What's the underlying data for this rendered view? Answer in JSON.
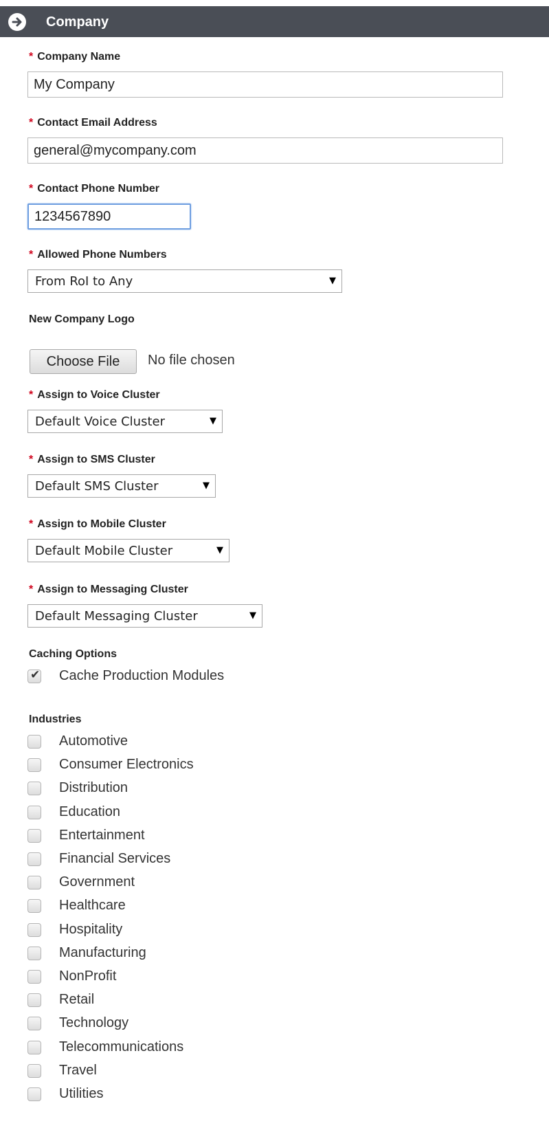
{
  "header": {
    "title": "Company",
    "icon": "arrow-right-circle-icon"
  },
  "form": {
    "company_name": {
      "required": "*",
      "label": "Company Name",
      "value": "My Company"
    },
    "contact_email": {
      "required": "*",
      "label": "Contact Email Address",
      "value": "general@mycompany.com"
    },
    "contact_phone": {
      "required": "*",
      "label": "Contact Phone Number",
      "value": "1234567890"
    },
    "allowed_phone_numbers": {
      "required": "*",
      "label": "Allowed Phone Numbers",
      "selected": "From RoI to Any"
    },
    "logo": {
      "label": "New Company Logo",
      "button": "Choose File",
      "status": "No file chosen"
    },
    "voice_cluster": {
      "required": "*",
      "label": "Assign to Voice Cluster",
      "selected": "Default Voice Cluster"
    },
    "sms_cluster": {
      "required": "*",
      "label": "Assign to SMS Cluster",
      "selected": "Default SMS Cluster"
    },
    "mobile_cluster": {
      "required": "*",
      "label": "Assign to Mobile Cluster",
      "selected": "Default Mobile Cluster"
    },
    "messaging_cluster": {
      "required": "*",
      "label": "Assign to Messaging Cluster",
      "selected": "Default Messaging Cluster"
    },
    "caching": {
      "label": "Caching Options",
      "option": {
        "label": "Cache Production Modules",
        "checked": true
      }
    },
    "industries": {
      "label": "Industries",
      "items": [
        {
          "label": "Automotive",
          "checked": false
        },
        {
          "label": "Consumer Electronics",
          "checked": false
        },
        {
          "label": "Distribution",
          "checked": false
        },
        {
          "label": "Education",
          "checked": false
        },
        {
          "label": "Entertainment",
          "checked": false
        },
        {
          "label": "Financial Services",
          "checked": false
        },
        {
          "label": "Government",
          "checked": false
        },
        {
          "label": "Healthcare",
          "checked": false
        },
        {
          "label": "Hospitality",
          "checked": false
        },
        {
          "label": "Manufacturing",
          "checked": false
        },
        {
          "label": "NonProfit",
          "checked": false
        },
        {
          "label": "Retail",
          "checked": false
        },
        {
          "label": "Technology",
          "checked": false
        },
        {
          "label": "Telecommunications",
          "checked": false
        },
        {
          "label": "Travel",
          "checked": false
        },
        {
          "label": "Utilities",
          "checked": false
        }
      ]
    }
  },
  "colors": {
    "header_bg": "#4a4e56",
    "required_star": "#d0021b",
    "focus_border": "#6e9ee0"
  }
}
